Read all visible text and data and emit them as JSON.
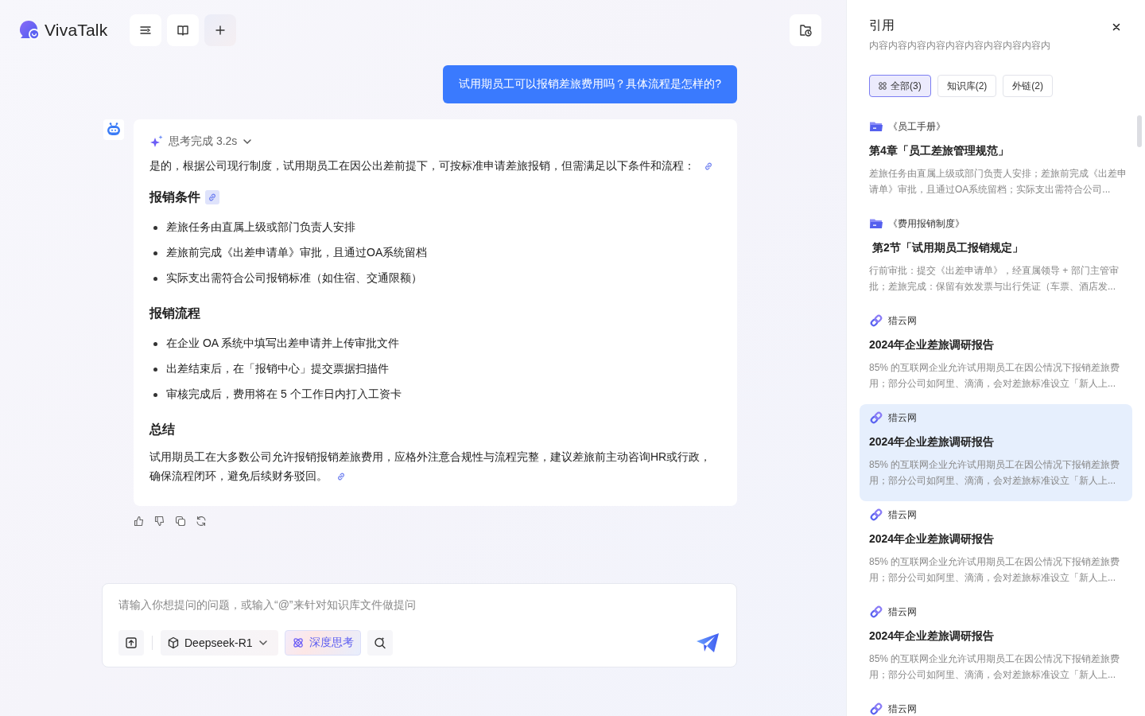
{
  "app": {
    "name": "VivaTalk"
  },
  "user_message": "试用期员工可以报销差旅费用吗？具体流程是怎样的?",
  "answer": {
    "thinking": {
      "label": "思考完成 3.2s",
      "expanded": false
    },
    "blocks": [
      {
        "kind": "paragraph",
        "text": "是的，根据公司现行制度，试用期员工在因公出差前提下，可按标准申请差旅报销，但需满足以下条件和流程：",
        "citation": {
          "highlighted": false
        }
      },
      {
        "kind": "heading",
        "text": "报销条件",
        "citation": {
          "highlighted": true
        }
      },
      {
        "kind": "bullet",
        "text": "差旅任务由直属上级或部门负责人安排"
      },
      {
        "kind": "bullet",
        "text": "差旅前完成《出差申请单》审批，且通过OA系统留档"
      },
      {
        "kind": "bullet",
        "text": "实际支出需符合公司报销标准（如住宿、交通限额）"
      },
      {
        "kind": "heading",
        "text": "报销流程"
      },
      {
        "kind": "bullet",
        "text": "在企业 OA 系统中填写出差申请并上传审批文件"
      },
      {
        "kind": "bullet",
        "text": "出差结束后，在「报销中心」提交票据扫描件"
      },
      {
        "kind": "bullet",
        "text": "审核完成后，费用将在 5 个工作日内打入工资卡"
      },
      {
        "kind": "heading",
        "text": "总结"
      },
      {
        "kind": "paragraph",
        "text": "试用期员工在大多数公司允许报销报销差旅费用，应格外注意合规性与流程完整，建议差旅前主动咨询HR或行政，确保流程闭环，避免后续财务驳回。",
        "citation": {
          "highlighted": false
        }
      }
    ]
  },
  "input": {
    "placeholder": "请输入你想提问的问题，或输入“@”来针对知识库文件做提问",
    "model": "Deepseek-R1",
    "deep_think": {
      "label": "深度思考",
      "on": true
    }
  },
  "references": {
    "title": "引用",
    "subtitle": "内容内容内容内容内容内容内容内容内容内",
    "filters": [
      {
        "label": "全部(3)",
        "selected": true
      },
      {
        "label": "知识库(2)",
        "selected": false
      },
      {
        "label": "外链(2)",
        "selected": false
      }
    ],
    "items": [
      {
        "kind": "document",
        "source": "《员工手册》",
        "title": "第4章「员工差旅管理规范」",
        "excerpt": "差旅任务由直属上级或部门负责人安排；差旅前完成《出差申请单》审批，且通过OA系统留档；实际支出需符合公司...",
        "selected": false
      },
      {
        "kind": "document",
        "source": "《费用报销制度》",
        "title": " 第2节「试用期员工报销规定」",
        "excerpt": "行前审批：提交《出差申请单》，经直属领导 + 部门主管审批；差旅完成：保留有效发票与出行凭证（车票、酒店发...",
        "selected": false
      },
      {
        "kind": "web",
        "source": "猎云网",
        "title": "2024年企业差旅调研报告",
        "excerpt": "85% 的互联网企业允许试用期员工在因公情况下报销差旅费用；部分公司如阿里、滴滴，会对差旅标准设立「新人上...",
        "selected": false
      },
      {
        "kind": "web",
        "source": "猎云网",
        "title": "2024年企业差旅调研报告",
        "excerpt": "85% 的互联网企业允许试用期员工在因公情况下报销差旅费用；部分公司如阿里、滴滴，会对差旅标准设立「新人上...",
        "selected": true
      },
      {
        "kind": "web",
        "source": "猎云网",
        "title": "2024年企业差旅调研报告",
        "excerpt": "85% 的互联网企业允许试用期员工在因公情况下报销差旅费用；部分公司如阿里、滴滴，会对差旅标准设立「新人上...",
        "selected": false
      },
      {
        "kind": "web",
        "source": "猎云网",
        "title": "2024年企业差旅调研报告",
        "excerpt": "85% 的互联网企业允许试用期员工在因公情况下报销差旅费用；部分公司如阿里、滴滴，会对差旅标准设立「新人上...",
        "selected": false
      },
      {
        "kind": "web",
        "source": "猎云网",
        "selected": false
      }
    ]
  }
}
